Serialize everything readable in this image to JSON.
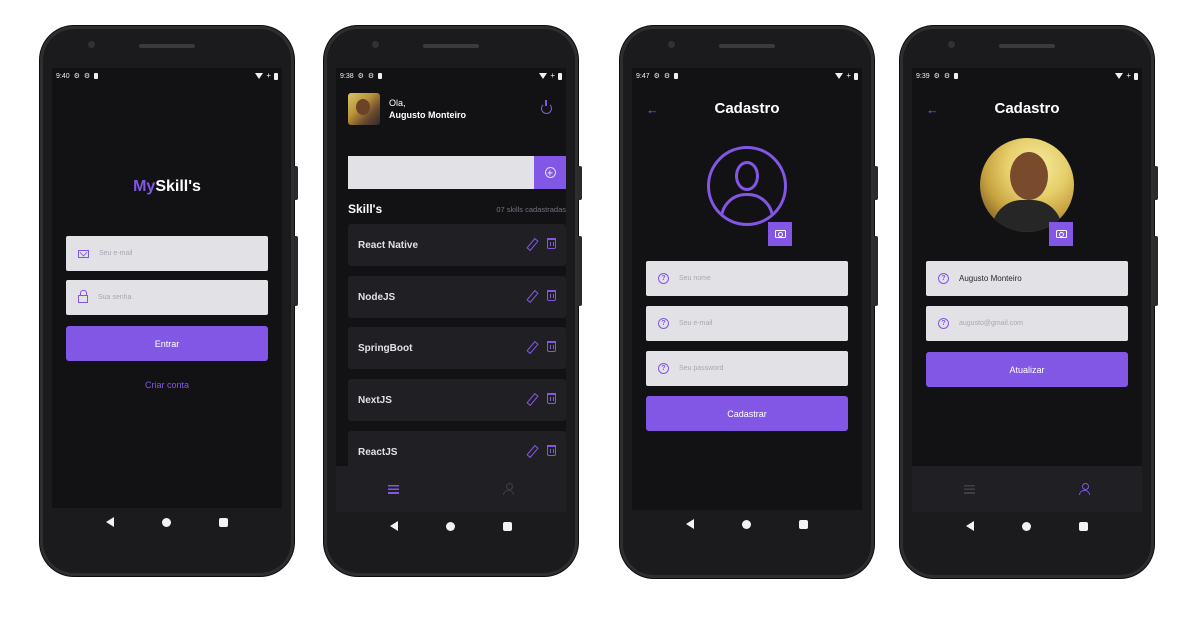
{
  "colors": {
    "accent": "#8257e5",
    "background": "#121214",
    "input": "#e1e1e6",
    "card": "#202024"
  },
  "login": {
    "status_time": "9:40",
    "brand_my": "My",
    "brand_rest": "Skill's",
    "email_placeholder": "Seu e-mail",
    "password_placeholder": "Sua senha",
    "submit_label": "Entrar",
    "create_account_label": "Criar conta"
  },
  "skills": {
    "status_time": "9:38",
    "greeting": "Ola,",
    "user_name": "Augusto Monteiro",
    "section_title": "Skill's",
    "count_label": "07 skills cadastradas",
    "items": [
      {
        "label": "React Native"
      },
      {
        "label": "NodeJS"
      },
      {
        "label": "SpringBoot"
      },
      {
        "label": "NextJS"
      },
      {
        "label": "ReactJS"
      }
    ]
  },
  "signup": {
    "status_time": "9:47",
    "title": "Cadastro",
    "name_placeholder": "Seu nome",
    "email_placeholder": "Seu e-mail",
    "password_placeholder": "Seu password",
    "submit_label": "Cadastrar"
  },
  "profile": {
    "status_time": "9:39",
    "title": "Cadastro",
    "name_value": "Augusto Monteiro",
    "email_placeholder": "augusto@gmail.com",
    "submit_label": "Atualizar"
  },
  "icons": [
    "mail-icon",
    "lock-icon",
    "power-icon",
    "add-icon",
    "edit-icon",
    "trash-icon",
    "list-icon",
    "user-icon",
    "back-arrow-icon",
    "help-icon",
    "camera-icon"
  ]
}
